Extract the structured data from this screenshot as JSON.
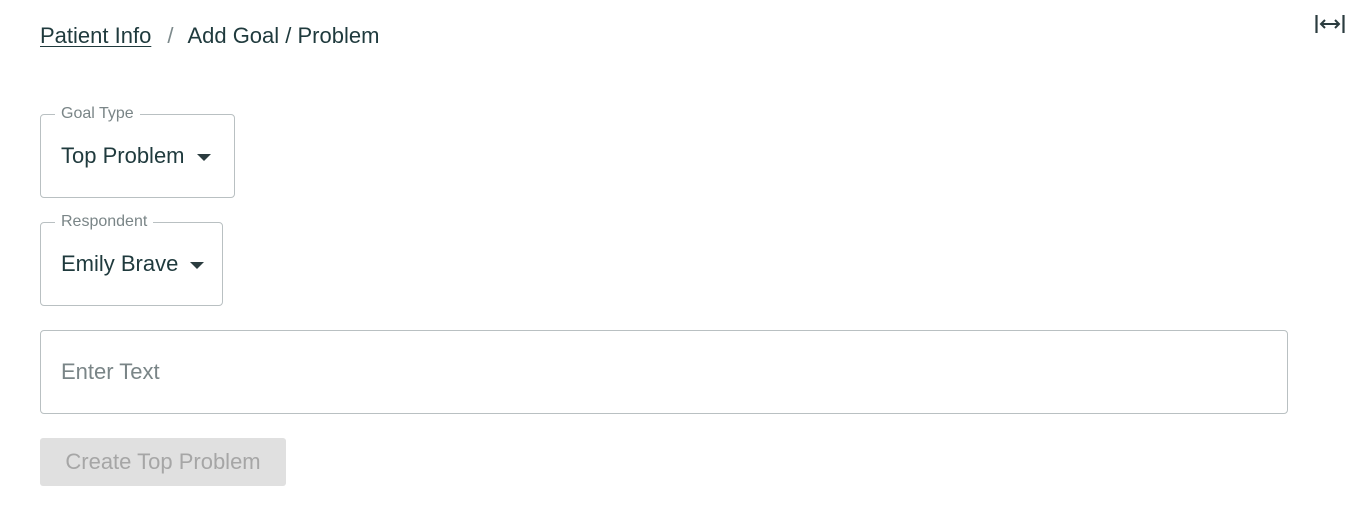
{
  "breadcrumb": {
    "parent_label": "Patient Info",
    "separator": "/",
    "current_label": "Add Goal / Problem"
  },
  "header": {
    "expand_icon": "expand-horizontal-icon"
  },
  "form": {
    "goal_type": {
      "label": "Goal Type",
      "value": "Top Problem",
      "icon": "caret-down-icon"
    },
    "respondent": {
      "label": "Respondent",
      "value": "Emily Brave",
      "icon": "caret-down-icon"
    },
    "text_input": {
      "value": "",
      "placeholder": "Enter Text"
    },
    "submit": {
      "label": "Create Top Problem",
      "disabled": true
    }
  },
  "colors": {
    "text": "#1f3a3d",
    "border": "#b9c0c2",
    "muted": "#7a8587",
    "button_disabled_bg": "#e0e0e0",
    "button_disabled_text": "#a6a6a6"
  }
}
